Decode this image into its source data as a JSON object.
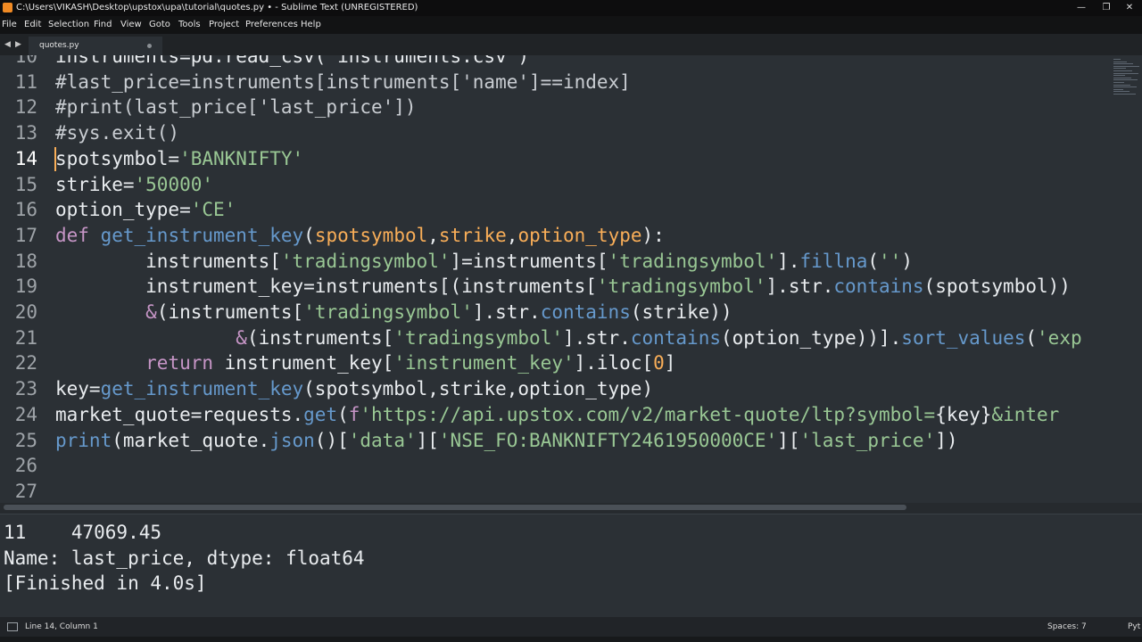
{
  "window": {
    "title": "C:\\Users\\VIKASH\\Desktop\\upstox\\upa\\tutorial\\quotes.py • - Sublime Text (UNREGISTERED)",
    "app_icon": "sublime-text-icon",
    "accent_color": "#f08a24"
  },
  "menu": [
    "File",
    "Edit",
    "Selection",
    "Find",
    "View",
    "Goto",
    "Tools",
    "Project",
    "Preferences",
    "Help"
  ],
  "tabs": [
    {
      "label": "quotes.py",
      "modified": true
    }
  ],
  "editor": {
    "active_line": "14",
    "lines": [
      {
        "num": "10",
        "tokens": [
          {
            "t": "instruments=pd.read_csv('instruments.csv')",
            "c": ""
          }
        ]
      },
      {
        "num": "11",
        "tokens": [
          {
            "t": "#last_price=instruments[instruments['name']==index]",
            "c": "cm"
          }
        ]
      },
      {
        "num": "12",
        "tokens": [
          {
            "t": "#print(last_price['last_price'])",
            "c": "cm"
          }
        ]
      },
      {
        "num": "13",
        "tokens": [
          {
            "t": "#sys.exit()",
            "c": "cm"
          }
        ]
      },
      {
        "num": "14",
        "tokens": [
          {
            "t": "spotsymbol=",
            "c": ""
          },
          {
            "t": "'BANKNIFTY'",
            "c": "str"
          }
        ]
      },
      {
        "num": "15",
        "tokens": [
          {
            "t": "strike=",
            "c": ""
          },
          {
            "t": "'50000'",
            "c": "str"
          }
        ]
      },
      {
        "num": "16",
        "tokens": [
          {
            "t": "option_type=",
            "c": ""
          },
          {
            "t": "'CE'",
            "c": "str"
          }
        ]
      },
      {
        "num": "17",
        "tokens": [
          {
            "t": "def",
            "c": "kw"
          },
          {
            "t": " ",
            "c": ""
          },
          {
            "t": "get_instrument_key",
            "c": "fn"
          },
          {
            "t": "(",
            "c": ""
          },
          {
            "t": "spotsymbol",
            "c": "var"
          },
          {
            "t": ",",
            "c": ""
          },
          {
            "t": "strike",
            "c": "var"
          },
          {
            "t": ",",
            "c": ""
          },
          {
            "t": "option_type",
            "c": "var"
          },
          {
            "t": "):",
            "c": ""
          }
        ]
      },
      {
        "num": "18",
        "tokens": [
          {
            "t": "        instruments[",
            "c": ""
          },
          {
            "t": "'tradingsymbol'",
            "c": "str"
          },
          {
            "t": "]=instruments[",
            "c": ""
          },
          {
            "t": "'tradingsymbol'",
            "c": "str"
          },
          {
            "t": "].",
            "c": ""
          },
          {
            "t": "fillna",
            "c": "fn"
          },
          {
            "t": "(",
            "c": ""
          },
          {
            "t": "''",
            "c": "str"
          },
          {
            "t": ")",
            "c": ""
          }
        ]
      },
      {
        "num": "19",
        "tokens": [
          {
            "t": "        instrument_key=instruments[(instruments[",
            "c": ""
          },
          {
            "t": "'tradingsymbol'",
            "c": "str"
          },
          {
            "t": "].str.",
            "c": ""
          },
          {
            "t": "contains",
            "c": "fn"
          },
          {
            "t": "(spotsymbol))",
            "c": ""
          }
        ]
      },
      {
        "num": "20",
        "tokens": [
          {
            "t": "        ",
            "c": ""
          },
          {
            "t": "&",
            "c": "kw"
          },
          {
            "t": "(instruments[",
            "c": ""
          },
          {
            "t": "'tradingsymbol'",
            "c": "str"
          },
          {
            "t": "].str.",
            "c": ""
          },
          {
            "t": "contains",
            "c": "fn"
          },
          {
            "t": "(strike))",
            "c": ""
          }
        ]
      },
      {
        "num": "21",
        "tokens": [
          {
            "t": "                ",
            "c": ""
          },
          {
            "t": "&",
            "c": "kw"
          },
          {
            "t": "(instruments[",
            "c": ""
          },
          {
            "t": "'tradingsymbol'",
            "c": "str"
          },
          {
            "t": "].str.",
            "c": ""
          },
          {
            "t": "contains",
            "c": "fn"
          },
          {
            "t": "(option_type))].",
            "c": ""
          },
          {
            "t": "sort_values",
            "c": "fn"
          },
          {
            "t": "(",
            "c": ""
          },
          {
            "t": "'exp",
            "c": "str"
          }
        ]
      },
      {
        "num": "22",
        "tokens": [
          {
            "t": "        ",
            "c": ""
          },
          {
            "t": "return",
            "c": "kw"
          },
          {
            "t": " instrument_key[",
            "c": ""
          },
          {
            "t": "'instrument_key'",
            "c": "str"
          },
          {
            "t": "].iloc[",
            "c": ""
          },
          {
            "t": "0",
            "c": "var"
          },
          {
            "t": "]",
            "c": ""
          }
        ]
      },
      {
        "num": "23",
        "tokens": [
          {
            "t": "key=",
            "c": ""
          },
          {
            "t": "get_instrument_key",
            "c": "fn"
          },
          {
            "t": "(spotsymbol,strike,option_type)",
            "c": ""
          }
        ]
      },
      {
        "num": "24",
        "tokens": [
          {
            "t": "market_quote=requests.",
            "c": ""
          },
          {
            "t": "get",
            "c": "fn"
          },
          {
            "t": "(",
            "c": ""
          },
          {
            "t": "f",
            "c": "kw"
          },
          {
            "t": "'https://api.upstox.com/v2/market-quote/ltp?symbol=",
            "c": "str"
          },
          {
            "t": "{key}",
            "c": ""
          },
          {
            "t": "&inter",
            "c": "str"
          }
        ]
      },
      {
        "num": "25",
        "tokens": [
          {
            "t": "print",
            "c": "fn"
          },
          {
            "t": "(market_quote.",
            "c": ""
          },
          {
            "t": "json",
            "c": "fn"
          },
          {
            "t": "()[",
            "c": ""
          },
          {
            "t": "'data'",
            "c": "str"
          },
          {
            "t": "][",
            "c": ""
          },
          {
            "t": "'NSE_FO:BANKNIFTY2461950000CE'",
            "c": "str"
          },
          {
            "t": "][",
            "c": ""
          },
          {
            "t": "'last_price'",
            "c": "str"
          },
          {
            "t": "])",
            "c": ""
          }
        ]
      },
      {
        "num": "26",
        "tokens": []
      },
      {
        "num": "27",
        "tokens": []
      }
    ]
  },
  "output": {
    "lines": [
      "11    47069.45",
      "Name: last_price, dtype: float64",
      "[Finished in 4.0s]"
    ]
  },
  "status": {
    "position": "Line 14, Column 1",
    "indent": "Spaces: 7",
    "syntax": "Pyt"
  }
}
